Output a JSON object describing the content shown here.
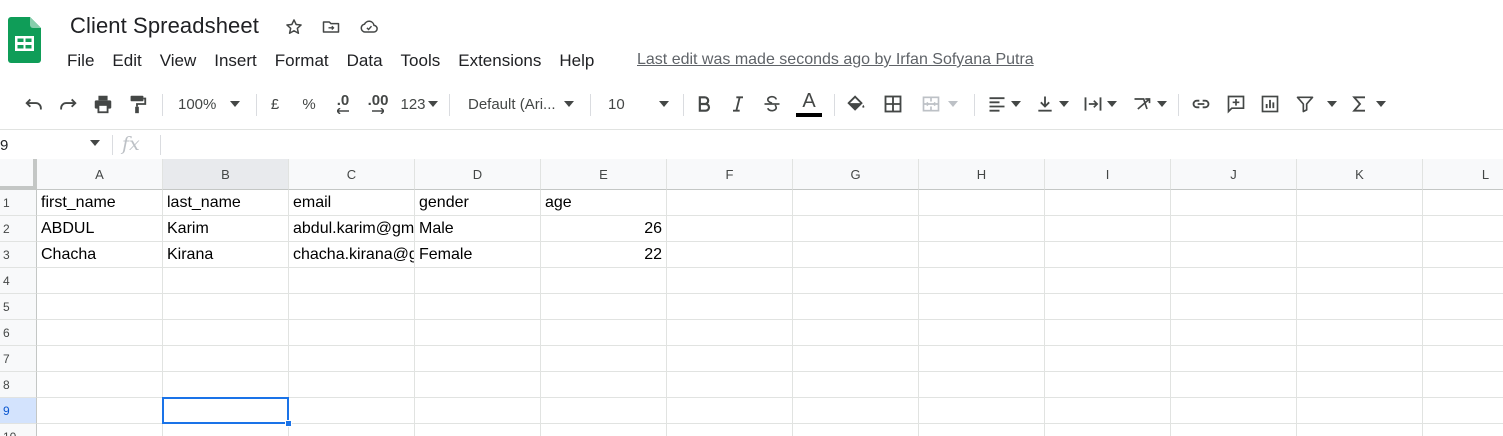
{
  "app": {
    "title": "Client Spreadsheet",
    "last_edit": "Last edit was made seconds ago by Irfan Sofyana Putra",
    "colors": {
      "brand": "#0f9d58",
      "selection": "#1a73e8"
    }
  },
  "menu": [
    "File",
    "Edit",
    "View",
    "Insert",
    "Format",
    "Data",
    "Tools",
    "Extensions",
    "Help"
  ],
  "toolbar": {
    "zoom": "100%",
    "currency": "£",
    "percent": "%",
    "decrease_decimal": ".0",
    "increase_decimal": ".00",
    "more_formats": "123",
    "font": "Default (Ari...",
    "font_size": "10",
    "text_color_letter": "A",
    "icons": [
      "undo-icon",
      "redo-icon",
      "print-icon",
      "paint-format-icon",
      "bold-icon",
      "italic-icon",
      "strikethrough-icon",
      "text-color-icon",
      "fill-color-icon",
      "borders-icon",
      "merge-cells-icon",
      "align-left-icon",
      "valign-bottom-icon",
      "text-wrap-icon",
      "text-rotation-icon",
      "link-icon",
      "comment-icon",
      "chart-icon",
      "filter-icon",
      "functions-icon"
    ]
  },
  "formula_bar": {
    "name_box": "9",
    "fx": "fx",
    "value": ""
  },
  "grid": {
    "columns": [
      "A",
      "B",
      "C",
      "D",
      "E",
      "F",
      "G",
      "H",
      "I",
      "J",
      "K",
      "L"
    ],
    "rows": [
      "1",
      "2",
      "3",
      "4",
      "5",
      "6",
      "7",
      "8",
      "9",
      "10"
    ],
    "active_column": "B",
    "active_row": "9",
    "cells": [
      [
        "first_name",
        "last_name",
        "email",
        "gender",
        "age"
      ],
      [
        "ABDUL",
        "Karim",
        "abdul.karim@gmail.com",
        "Male",
        "26"
      ],
      [
        "Chacha",
        "Kirana",
        "chacha.kirana@gmail.com",
        "Female",
        "22"
      ]
    ]
  }
}
